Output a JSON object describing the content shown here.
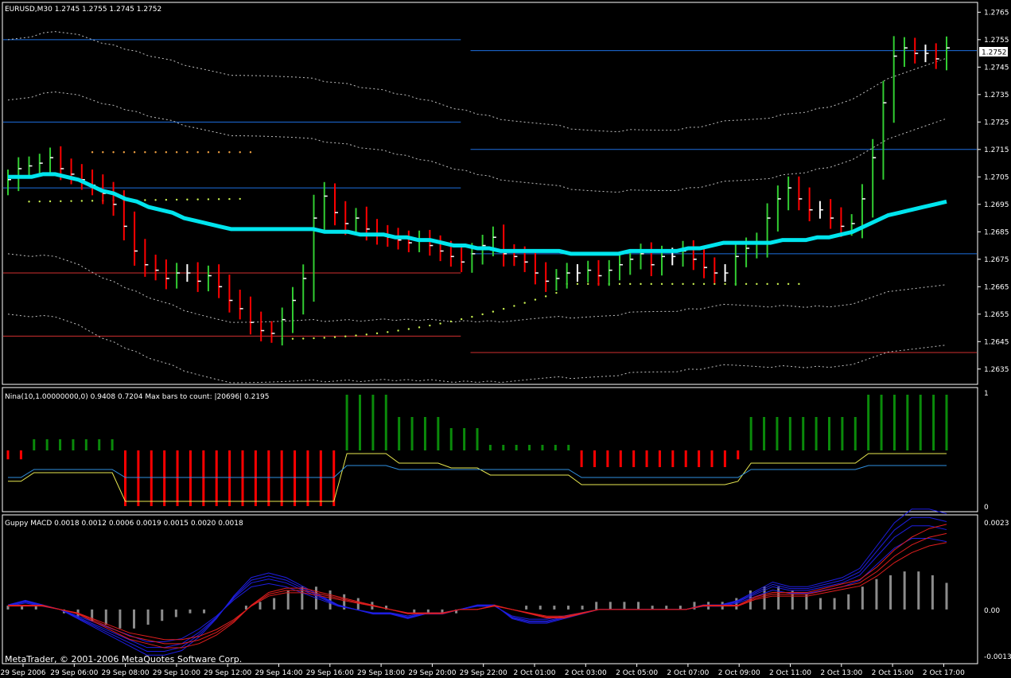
{
  "panels": {
    "main_title": "EURUSD,M30  1.2745 1.2755 1.2745 1.2752",
    "nina_title": "Nina(10,1.00000000,0) 0.9408 0.7204  Max bars to count: |20696|  0.2195",
    "macd_title": "Guppy MACD 0.0018 0.0012 0.0006 0.0019 0.0015 0.0020 0.0018"
  },
  "copyright": "MetaTrader, © 2001-2006 MetaQuotes Software Corp.",
  "current_price_label": "1.2752",
  "colors": {
    "background": "#000000",
    "bull": "#32CD32",
    "bear": "#FF0000",
    "neutral": "#FFFFFF",
    "ema": "#00E5EE",
    "hline_blue": "#1E6FE0",
    "hline_red": "#D03030",
    "dots_green": "#C8F050",
    "dots_orange": "#F0A040",
    "nina_yellow": "#E8E850",
    "nina_blue": "#3090E0",
    "macd_blue": "#1E1EE0",
    "macd_red": "#E01E1E",
    "macd_hist": "#8C8C8C"
  },
  "chart_data": [
    {
      "type": "ohlc",
      "name": "main",
      "ylim": [
        1.263,
        1.2768
      ],
      "y_ticks": [
        "1.2765",
        "1.2755",
        "1.2745",
        "1.2735",
        "1.2725",
        "1.2715",
        "1.2705",
        "1.2695",
        "1.2685",
        "1.2675",
        "1.2665",
        "1.2655",
        "1.2645",
        "1.2635"
      ],
      "x_labels": [
        "29 Sep 2006",
        "29 Sep 06:00",
        "29 Sep 08:00",
        "29 Sep 10:00",
        "29 Sep 12:00",
        "29 Sep 14:00",
        "29 Sep 16:00",
        "29 Sep 18:00",
        "29 Sep 20:00",
        "29 Sep 22:00",
        "2 Oct 01:00",
        "2 Oct 03:00",
        "2 Oct 05:00",
        "2 Oct 07:00",
        "2 Oct 09:00",
        "2 Oct 11:00",
        "2 Oct 13:00",
        "2 Oct 15:00",
        "2 Oct 17:00"
      ],
      "closes": [
        1.2704,
        1.2708,
        1.2709,
        1.271,
        1.2712,
        1.2708,
        1.2706,
        1.2704,
        1.2702,
        1.2699,
        1.2695,
        1.2687,
        1.2678,
        1.2673,
        1.2671,
        1.2668,
        1.267,
        1.267,
        1.2667,
        1.2669,
        1.2665,
        1.266,
        1.2657,
        1.2652,
        1.2649,
        1.2648,
        1.2653,
        1.266,
        1.2668,
        1.269,
        1.2698,
        1.2692,
        1.2688,
        1.269,
        1.2686,
        1.2684,
        1.2683,
        1.2682,
        1.2681,
        1.2682,
        1.268,
        1.2678,
        1.2676,
        1.2674,
        1.2677,
        1.268,
        1.2683,
        1.2677,
        1.2676,
        1.2674,
        1.267,
        1.2667,
        1.2668,
        1.267,
        1.267,
        1.2671,
        1.2669,
        1.2671,
        1.2673,
        1.2675,
        1.2677,
        1.2673,
        1.2676,
        1.2676,
        1.2678,
        1.2675,
        1.2672,
        1.267,
        1.267,
        1.2676,
        1.2679,
        1.2681,
        1.269,
        1.2697,
        1.2701,
        1.2697,
        1.2693,
        1.2693,
        1.269,
        1.2687,
        1.2688,
        1.2697,
        1.2712,
        1.2732,
        1.2749,
        1.2752,
        1.275,
        1.275,
        1.2748,
        1.2752
      ],
      "ema": [
        1.2705,
        1.2705,
        1.2705,
        1.2706,
        1.2706,
        1.2705,
        1.2704,
        1.2702,
        1.27,
        1.2699,
        1.2697,
        1.2696,
        1.2694,
        1.2693,
        1.2692,
        1.269,
        1.2689,
        1.2688,
        1.2687,
        1.2686,
        1.2686,
        1.2686,
        1.2686,
        1.2686,
        1.2686,
        1.2686,
        1.2686,
        1.2685,
        1.2685,
        1.2685,
        1.2684,
        1.2684,
        1.2684,
        1.2683,
        1.2683,
        1.2682,
        1.2682,
        1.2681,
        1.268,
        1.268,
        1.2679,
        1.2679,
        1.2678,
        1.2678,
        1.2678,
        1.2678,
        1.2678,
        1.2678,
        1.2677,
        1.2677,
        1.2677,
        1.2677,
        1.2677,
        1.2678,
        1.2678,
        1.2678,
        1.2678,
        1.2678,
        1.2679,
        1.2679,
        1.268,
        1.2681,
        1.2681,
        1.2681,
        1.2681,
        1.2681,
        1.2682,
        1.2682,
        1.2682,
        1.2683,
        1.2683,
        1.2684,
        1.2685,
        1.2687,
        1.2689,
        1.2691,
        1.2692,
        1.2693,
        1.2694,
        1.2695,
        1.2696
      ],
      "hlines": [
        {
          "from": 0.0,
          "to": 0.47,
          "price": 1.2755,
          "color": "hline_blue"
        },
        {
          "from": 0.0,
          "to": 0.47,
          "price": 1.2725,
          "color": "hline_blue"
        },
        {
          "from": 0.0,
          "to": 0.47,
          "price": 1.2701,
          "color": "hline_blue"
        },
        {
          "from": 0.0,
          "to": 0.47,
          "price": 1.267,
          "color": "hline_red"
        },
        {
          "from": 0.0,
          "to": 0.47,
          "price": 1.2647,
          "color": "hline_red"
        },
        {
          "from": 0.48,
          "to": 1.0,
          "price": 1.2751,
          "color": "hline_blue"
        },
        {
          "from": 0.48,
          "to": 1.0,
          "price": 1.2715,
          "color": "hline_blue"
        },
        {
          "from": 0.48,
          "to": 1.0,
          "price": 1.2677,
          "color": "hline_blue"
        },
        {
          "from": 0.48,
          "to": 1.0,
          "price": 1.2641,
          "color": "hline_red"
        }
      ]
    },
    {
      "type": "histogram",
      "name": "Nina",
      "ylim": [
        0,
        1
      ],
      "y_ticks": [
        "1",
        "0"
      ],
      "values": [
        -0.08,
        -0.08,
        0.1,
        0.1,
        0.1,
        0.1,
        0.1,
        0.1,
        0.1,
        -0.5,
        -0.5,
        -0.5,
        -0.5,
        -0.5,
        -0.5,
        -0.5,
        -0.5,
        -0.5,
        -0.5,
        -0.5,
        -0.5,
        -0.5,
        -0.5,
        -0.5,
        -0.5,
        -0.5,
        0.5,
        0.5,
        0.5,
        0.5,
        0.3,
        0.3,
        0.3,
        0.3,
        0.2,
        0.2,
        0.2,
        0.05,
        0.05,
        0.05,
        0.05,
        0.05,
        0.05,
        0.05,
        -0.15,
        -0.15,
        -0.15,
        -0.15,
        -0.15,
        -0.15,
        -0.15,
        -0.15,
        -0.15,
        -0.15,
        -0.15,
        -0.15,
        -0.08,
        0.3,
        0.3,
        0.3,
        0.3,
        0.3,
        0.3,
        0.3,
        0.3,
        0.3,
        0.5,
        0.5,
        0.5,
        0.5,
        0.5,
        0.5,
        0.5
      ]
    },
    {
      "type": "line",
      "name": "Guppy MACD",
      "ylim": [
        -0.0013,
        0.0023
      ],
      "y_ticks": [
        "0.0023",
        "0.00",
        "-0.0013"
      ],
      "hist": [
        0.0001,
        0.0001,
        0.0001,
        0.0,
        -0.0001,
        -0.0002,
        -0.0003,
        -0.0004,
        -0.0005,
        -0.0005,
        -0.0004,
        -0.0003,
        -0.0002,
        -0.0001,
        -0.0001,
        0.0,
        0.0,
        0.0001,
        0.0002,
        0.0003,
        0.0005,
        0.0006,
        0.0006,
        0.0005,
        0.0004,
        0.0003,
        0.0002,
        0.0001,
        0.0,
        -0.0001,
        -0.0001,
        -0.0001,
        -0.0001,
        0.0,
        0.0,
        0.0,
        0.0,
        0.0001,
        0.0001,
        0.0001,
        0.0001,
        0.0001,
        0.0002,
        0.0002,
        0.0002,
        0.0002,
        0.0001,
        0.0001,
        0.0001,
        0.0002,
        0.0002,
        0.0002,
        0.0003,
        0.0005,
        0.0006,
        0.0006,
        0.0005,
        0.0004,
        0.0003,
        0.0003,
        0.0004,
        0.0006,
        0.0008,
        0.0009,
        0.001,
        0.001,
        0.0009,
        0.0007
      ],
      "blue": [
        0.0001,
        0.0002,
        0.0001,
        0.0,
        -0.0002,
        -0.0004,
        -0.0006,
        -0.0008,
        -0.001,
        -0.001,
        -0.0009,
        -0.0006,
        -0.0002,
        0.0003,
        0.0007,
        0.0008,
        0.0007,
        0.0005,
        0.0003,
        0.0001,
        0.0,
        -0.0001,
        -0.0001,
        -0.0002,
        -0.0001,
        -0.0001,
        0.0,
        0.0001,
        0.0001,
        -0.0002,
        -0.0003,
        -0.0003,
        -0.0002,
        -0.0001,
        0.0,
        0.0,
        0.0,
        0.0,
        0.0,
        0.0,
        0.0001,
        0.0001,
        0.0002,
        0.0004,
        0.0006,
        0.0005,
        0.0005,
        0.0006,
        0.0007,
        0.0009,
        0.0014,
        0.0019,
        0.0022,
        0.0022,
        0.0021
      ],
      "red": [
        0.0001,
        0.0001,
        0.0001,
        0.0,
        -0.0001,
        -0.0003,
        -0.0005,
        -0.0007,
        -0.0008,
        -0.0009,
        -0.0009,
        -0.0008,
        -0.0006,
        -0.0003,
        0.0001,
        0.0004,
        0.0005,
        0.0005,
        0.0004,
        0.0003,
        0.0002,
        0.0001,
        0.0,
        -0.0001,
        -0.0001,
        -0.0001,
        0.0,
        0.0,
        0.0001,
        0.0,
        -0.0001,
        -0.0002,
        -0.0002,
        -0.0001,
        0.0,
        0.0,
        0.0,
        0.0,
        0.0,
        0.0,
        0.0001,
        0.0001,
        0.0001,
        0.0003,
        0.0004,
        0.0004,
        0.0004,
        0.0005,
        0.0006,
        0.0007,
        0.001,
        0.0014,
        0.0017,
        0.0019,
        0.002
      ]
    }
  ]
}
